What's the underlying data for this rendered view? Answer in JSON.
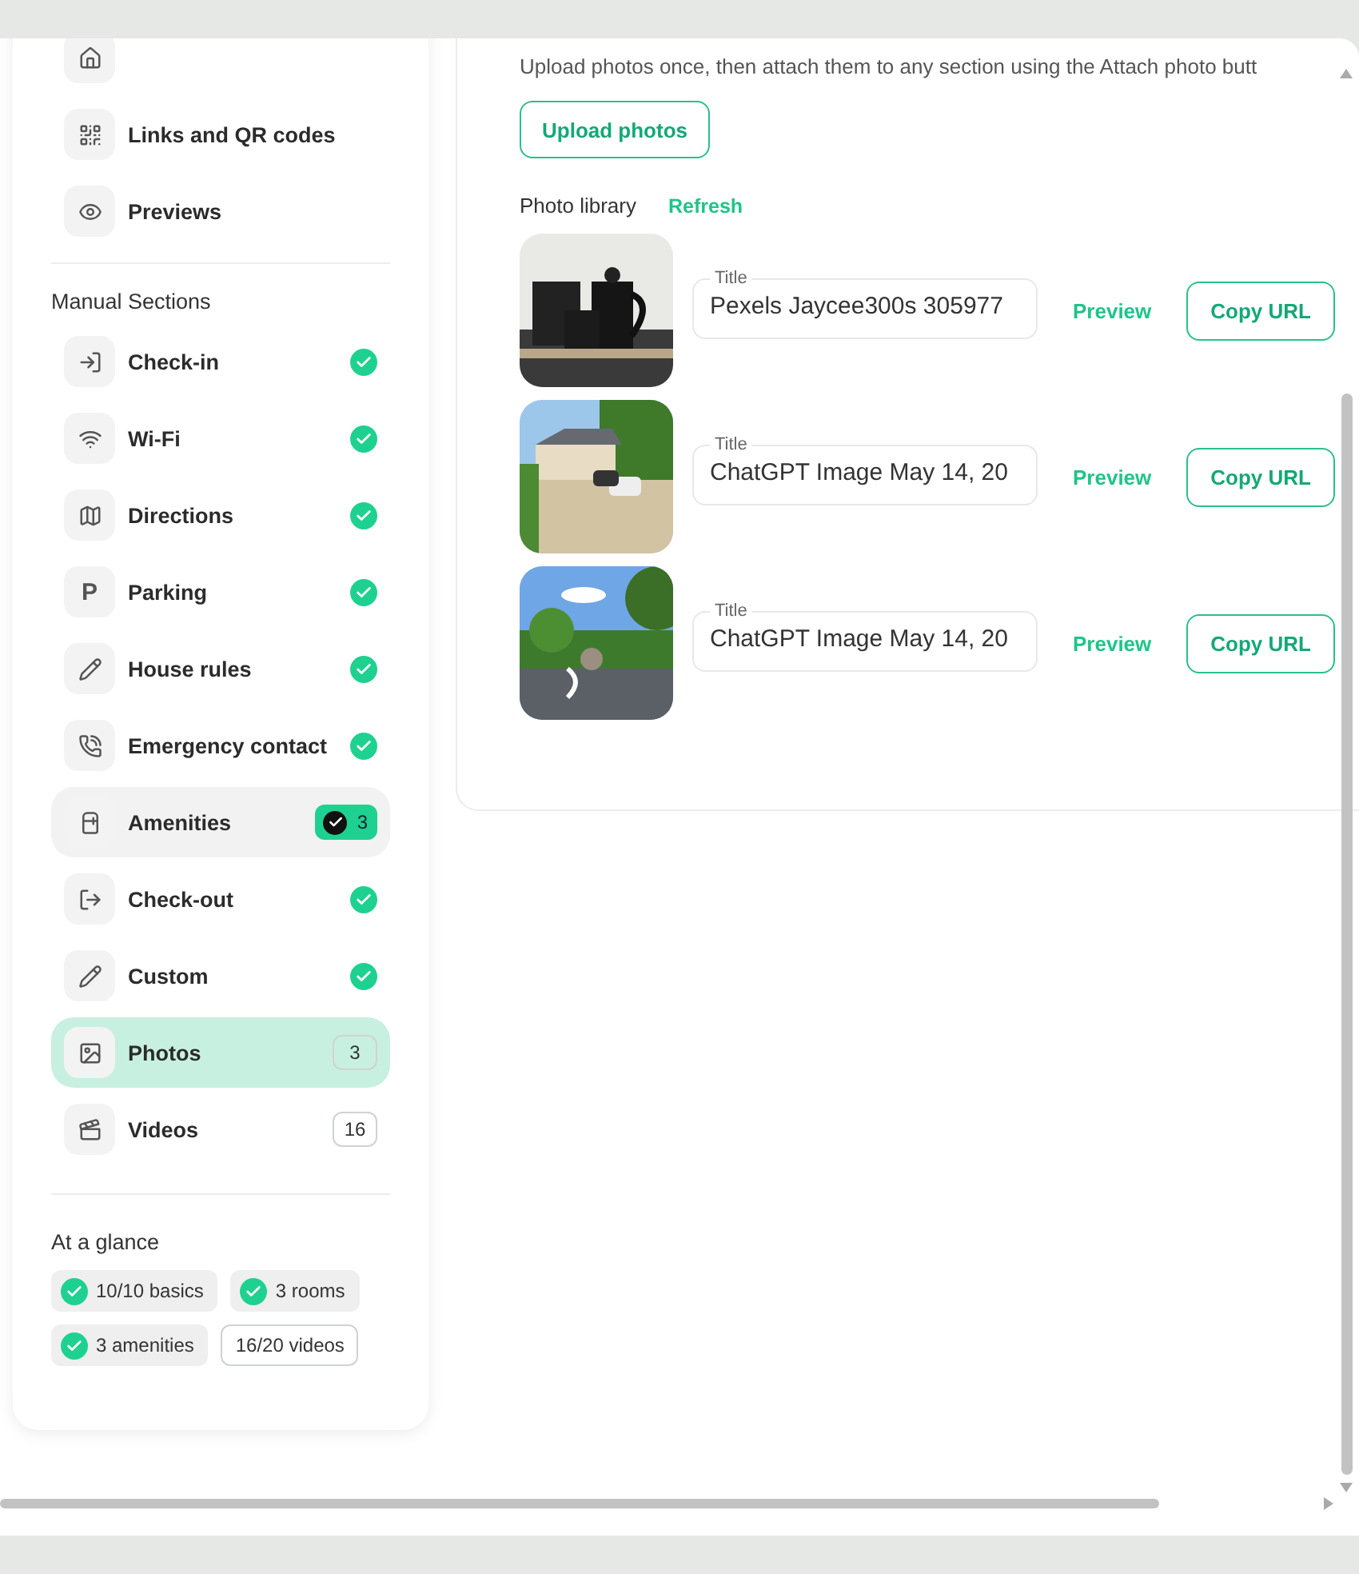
{
  "sidebar": {
    "top_items": [
      {
        "label": "Links and QR codes"
      },
      {
        "label": "Previews"
      }
    ],
    "sections_title": "Manual Sections",
    "sections": [
      {
        "label": "Check-in",
        "complete": true,
        "selected": false,
        "highlighted": false
      },
      {
        "label": "Wi-Fi",
        "complete": true,
        "selected": false,
        "highlighted": false
      },
      {
        "label": "Directions",
        "complete": true,
        "selected": false,
        "highlighted": false
      },
      {
        "label": "Parking",
        "icon_text": "P",
        "complete": true,
        "selected": false,
        "highlighted": false
      },
      {
        "label": "House rules",
        "complete": true,
        "selected": false,
        "highlighted": false
      },
      {
        "label": "Emergency contact",
        "complete": true,
        "selected": false,
        "highlighted": false
      },
      {
        "label": "Amenities",
        "complete": true,
        "count": "3",
        "selected": false,
        "highlighted": true
      },
      {
        "label": "Check-out",
        "complete": true,
        "selected": false,
        "highlighted": false
      },
      {
        "label": "Custom",
        "complete": true,
        "selected": false,
        "highlighted": false
      },
      {
        "label": "Photos",
        "complete": false,
        "count": "3",
        "selected": true,
        "highlighted": false
      },
      {
        "label": "Videos",
        "complete": false,
        "count": "16",
        "selected": false,
        "highlighted": false
      }
    ],
    "glance_title": "At a glance",
    "glance": [
      {
        "label": "10/10 basics",
        "checked": true
      },
      {
        "label": "3 rooms",
        "checked": true
      },
      {
        "label": "3 amenities",
        "checked": true
      },
      {
        "label": "16/20 videos",
        "checked": false
      }
    ]
  },
  "main": {
    "description": "Upload photos once, then attach them to any section using the Attach photo butt",
    "upload_button": "Upload photos",
    "library_title": "Photo library",
    "refresh": "Refresh",
    "photos": [
      {
        "kind": "picture",
        "field_label": "Title",
        "value": "Pexels Jaycee300s 305977",
        "preview": "Preview",
        "copy": "Copy URL"
      },
      {
        "kind": "picture",
        "field_label": "Title",
        "value": "ChatGPT Image May 14, 20",
        "preview": "Preview",
        "copy": "Copy URL"
      },
      {
        "kind": "picture",
        "field_label": "Title",
        "value": "ChatGPT Image May 14, 20",
        "preview": "Preview",
        "copy": "Copy URL"
      }
    ]
  }
}
